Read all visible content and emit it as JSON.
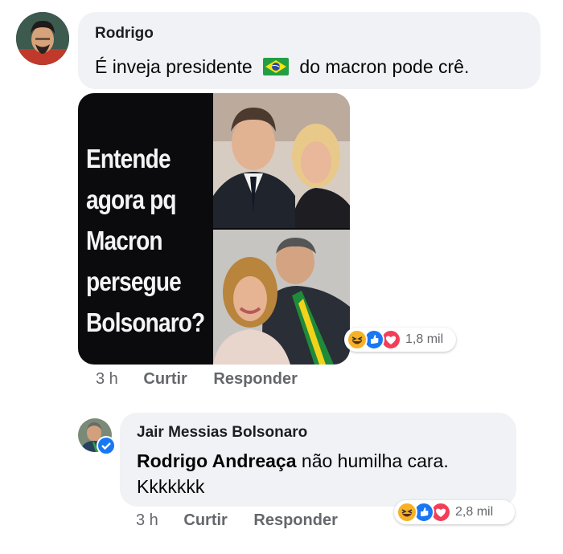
{
  "comment1": {
    "author": "Rodrigo",
    "text_before": "É inveja presidente",
    "flag": "🇧🇷",
    "text_after": "do macron pode crê.",
    "time": "3 h",
    "like_label": "Curtir",
    "reply_label": "Responder",
    "reaction_count": "1,8 mil"
  },
  "meme": {
    "text": "Entende agora pq Macron persegue Bolsonaro?"
  },
  "reply": {
    "author": "Jair Messias Bolsonaro",
    "mention": "Rodrigo Andreaça",
    "text": " não humilha cara. Kkkkkkk",
    "time": "3 h",
    "like_label": "Curtir",
    "reply_label": "Responder",
    "reaction_count": "2,8 mil"
  },
  "colors": {
    "bubble": "#f0f2f5",
    "like_blue": "#1877f2",
    "love_red": "#f33e58",
    "haha_yellow": "#f7b125",
    "meta_gray": "#65676b"
  }
}
